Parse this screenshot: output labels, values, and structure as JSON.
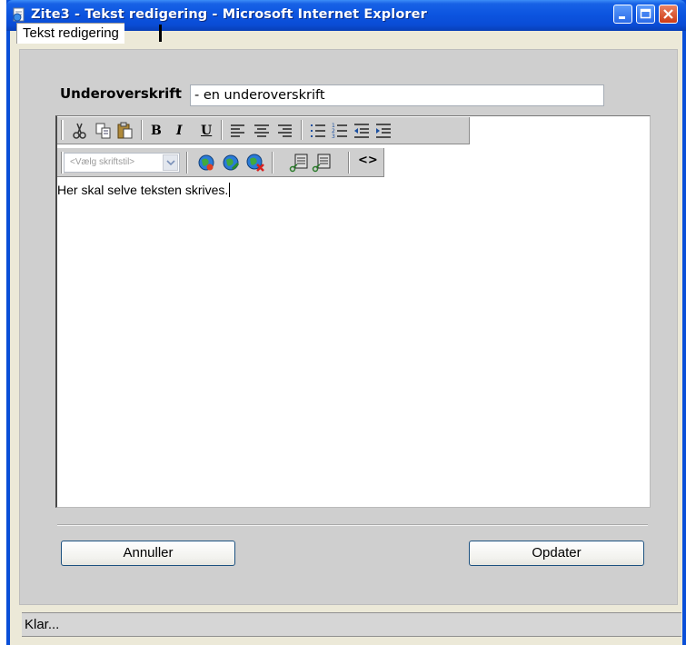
{
  "window": {
    "title": "Zite3 - Tekst redigering - Microsoft Internet Explorer",
    "controls": [
      "minimize-icon",
      "maximize-icon",
      "close-icon"
    ]
  },
  "tab": {
    "label": "Tekst redigering"
  },
  "subheading": {
    "label": "Underoverskrift",
    "value": "- en underoverskrift"
  },
  "toolbar": {
    "row1": [
      "cut-icon",
      "copy-icon",
      "paste-icon",
      "bold-icon",
      "italic-icon",
      "underline-icon",
      "align-left-icon",
      "align-center-icon",
      "align-right-icon",
      "unordered-list-icon",
      "ordered-list-icon",
      "outdent-icon",
      "indent-icon"
    ],
    "bold": "B",
    "italic": "I",
    "underline": "U",
    "font_select_value": "<Vælg skriftstil>",
    "row2": [
      "insert-link-icon",
      "edit-link-icon",
      "remove-link-icon",
      "insert-image-icon",
      "edit-image-icon",
      "source-code-icon"
    ],
    "source_glyph": "<>"
  },
  "editor": {
    "text": "Her skal selve teksten skrives."
  },
  "buttons": {
    "cancel": "Annuller",
    "update": "Opdater"
  },
  "status": {
    "text": "Klar..."
  },
  "colors": {
    "titlebar": "#0a4fd8",
    "panel": "#cfcfcf",
    "client": "#ece9d8"
  }
}
